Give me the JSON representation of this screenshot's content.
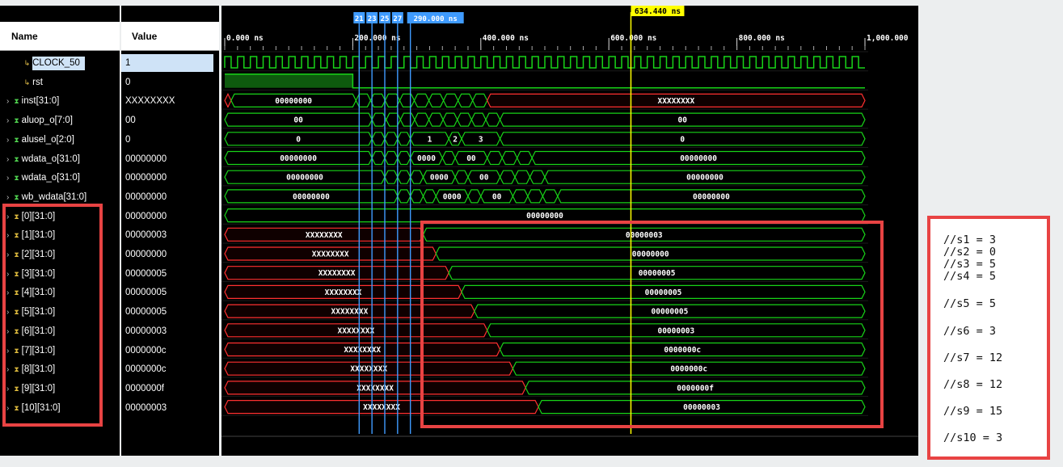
{
  "columns": {
    "name": "Name",
    "value": "Value"
  },
  "signals": [
    {
      "name": "CLOCK_50",
      "value": "1",
      "icon": "input-bit-icon"
    },
    {
      "name": "rst",
      "value": "0",
      "icon": "input-bit-icon"
    },
    {
      "name": "inst[31:0]",
      "value": "XXXXXXXX",
      "icon": "bus-icon"
    },
    {
      "name": "aluop_o[7:0]",
      "value": "00",
      "icon": "bus-icon"
    },
    {
      "name": "alusel_o[2:0]",
      "value": "0",
      "icon": "bus-icon"
    },
    {
      "name": "wdata_o[31:0]",
      "value": "00000000",
      "icon": "bus-icon"
    },
    {
      "name": "wdata_o[31:0]",
      "value": "00000000",
      "icon": "bus-icon"
    },
    {
      "name": "wb_wdata[31:0]",
      "value": "00000000",
      "icon": "bus-icon"
    },
    {
      "name": "[0][31:0]",
      "value": "00000000",
      "icon": "register-icon"
    },
    {
      "name": "[1][31:0]",
      "value": "00000003",
      "icon": "register-icon"
    },
    {
      "name": "[2][31:0]",
      "value": "00000000",
      "icon": "register-icon"
    },
    {
      "name": "[3][31:0]",
      "value": "00000005",
      "icon": "register-icon"
    },
    {
      "name": "[4][31:0]",
      "value": "00000005",
      "icon": "register-icon"
    },
    {
      "name": "[5][31:0]",
      "value": "00000005",
      "icon": "register-icon"
    },
    {
      "name": "[6][31:0]",
      "value": "00000003",
      "icon": "register-icon"
    },
    {
      "name": "[7][31:0]",
      "value": "0000000c",
      "icon": "register-icon"
    },
    {
      "name": "[8][31:0]",
      "value": "0000000c",
      "icon": "register-icon"
    },
    {
      "name": "[9][31:0]",
      "value": "0000000f",
      "icon": "register-icon"
    },
    {
      "name": "[10][31:0]",
      "value": "00000003",
      "icon": "register-icon"
    }
  ],
  "timeline": {
    "ticks": [
      "0.000 ns",
      "200.000 ns",
      "400.000 ns",
      "600.000 ns",
      "800.000 ns",
      "1,000.000"
    ],
    "cursor_label": "634.440 ns",
    "marker_labels": [
      "21",
      "23",
      "25",
      "27",
      "290.000 ns"
    ]
  },
  "waves": {
    "inst": [
      "00000000",
      "XXXXXXXX"
    ],
    "aluop": [
      "00",
      "00"
    ],
    "alusel": [
      "0",
      "1",
      "2",
      "3",
      "0"
    ],
    "wdata1": [
      "00000000",
      "0000",
      "00",
      "00000000"
    ],
    "wdata2": [
      "00000000",
      "0000",
      "00",
      "00000000"
    ],
    "wb": [
      "00000000",
      "0000",
      "00",
      "00000000"
    ],
    "reg0": "00000000",
    "regs": [
      [
        "XXXXXXXX",
        "00000003"
      ],
      [
        "XXXXXXXX",
        "00000000"
      ],
      [
        "XXXXXXXX",
        "00000005"
      ],
      [
        "XXXXXXXX",
        "00000005"
      ],
      [
        "XXXXXXXX",
        "00000005"
      ],
      [
        "XXXXXXXX",
        "00000003"
      ],
      [
        "XXXXXXXX",
        "0000000c"
      ],
      [
        "XXXXXXXX",
        "0000000c"
      ],
      [
        "XXXXXXXX",
        "0000000f"
      ],
      [
        "XXXXXXXX",
        "00000003"
      ]
    ]
  },
  "notes": [
    "//s1 = 3",
    "//s2 = 0",
    "//s3 = 5",
    "//s4 = 5",
    "//s5 = 5",
    "//s6 = 3",
    "//s7 = 12",
    "//s8 = 12",
    "//s9 = 15",
    "//s10 = 3"
  ],
  "colors": {
    "wave": "#18d418",
    "x_wave": "#ff3030",
    "cursor": "#ffff00",
    "marker": "#3f9bff",
    "highlight": "#e84343"
  }
}
